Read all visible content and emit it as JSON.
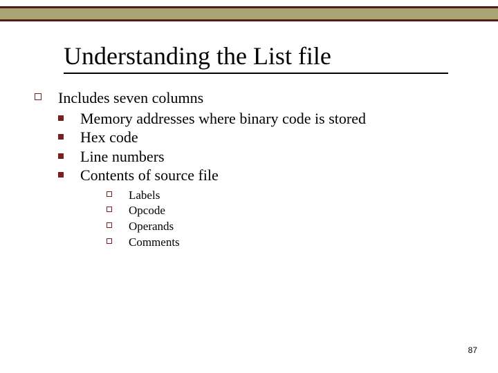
{
  "title": "Understanding the List file",
  "level1": "Includes seven columns",
  "level2": {
    "i0": "Memory addresses where binary code is stored",
    "i1": "Hex  code",
    "i2": "Line numbers",
    "i3": "Contents of source file"
  },
  "level3": {
    "i0": "Labels",
    "i1": "Opcode",
    "i2": "Operands",
    "i3": "Comments"
  },
  "page": "87"
}
